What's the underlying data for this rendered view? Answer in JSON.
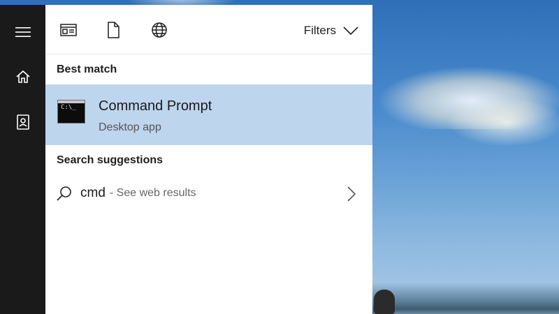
{
  "toolbar": {
    "icons": [
      "apps-icon",
      "document-icon",
      "web-globe-icon"
    ],
    "filters_label": "Filters"
  },
  "sidebar": {
    "items": [
      "hamburger-menu-icon",
      "home-icon",
      "contact-card-icon"
    ]
  },
  "best_match": {
    "heading": "Best match",
    "title": "Command Prompt",
    "subtitle": "Desktop app",
    "icon_text": "C:\\_",
    "highlight_color": "#bed5ee"
  },
  "suggestions": {
    "heading": "Search suggestions",
    "items": [
      {
        "query": "cmd",
        "hint": "- See web results"
      }
    ]
  },
  "colors": {
    "rail": "#1a1a1a",
    "panel": "#ffffff",
    "text": "#1f1f1f"
  }
}
